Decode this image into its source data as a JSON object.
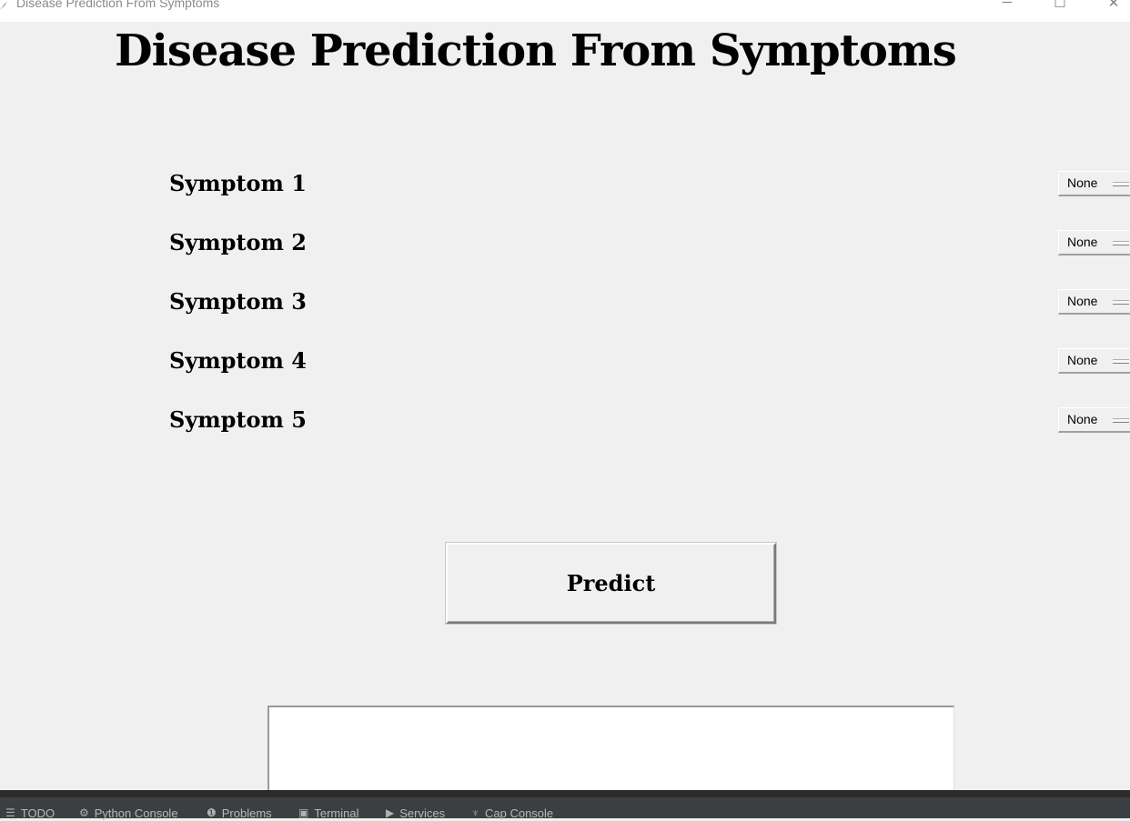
{
  "window": {
    "title": "Disease Prediction From Symptoms",
    "controls": {
      "minimize": "─",
      "maximize": "☐",
      "close": "✕"
    }
  },
  "main": {
    "heading": "Disease Prediction From Symptoms",
    "symptoms": [
      {
        "label": "Symptom 1",
        "value": "None"
      },
      {
        "label": "Symptom 2",
        "value": "None"
      },
      {
        "label": "Symptom 3",
        "value": "None"
      },
      {
        "label": "Symptom 4",
        "value": "None"
      },
      {
        "label": "Symptom 5",
        "value": "None"
      }
    ],
    "predict_label": "Predict",
    "result_text": ""
  },
  "tool_window_bar": {
    "tabs": [
      {
        "label": "TODO",
        "icon": "list-icon",
        "glyph": "☰"
      },
      {
        "label": "Python Console",
        "icon": "python-icon",
        "glyph": "⚙"
      },
      {
        "label": "Problems",
        "icon": "problems-icon",
        "glyph": "❶"
      },
      {
        "label": "Terminal",
        "icon": "terminal-icon",
        "glyph": "▣"
      },
      {
        "label": "Services",
        "icon": "services-icon",
        "glyph": "▶"
      },
      {
        "label": "Cap Console",
        "icon": "cap-icon",
        "glyph": "♆"
      }
    ]
  },
  "colors": {
    "window_bg": "#f0f0f0",
    "statusbar_bg": "#3c3f41",
    "result_bg": "#ffffff"
  }
}
